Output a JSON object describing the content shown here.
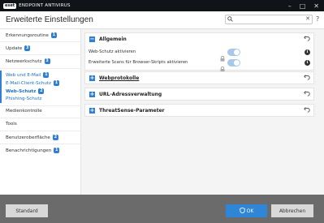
{
  "titlebar": {
    "logo": "eset",
    "product": "ENDPOINT ANTIVIRUS",
    "minimize": "–",
    "maximize": "□",
    "close": "✕"
  },
  "header": {
    "title": "Erweiterte Einstellungen",
    "search_value": "",
    "search_clear": "✕",
    "help": "?"
  },
  "sidebar": {
    "items": [
      {
        "label": "Erkennungsroutine",
        "badge": "1"
      },
      {
        "label": "Update",
        "badge": "3"
      },
      {
        "label": "Netzwerkschutz",
        "badge": "3"
      },
      {
        "label": "Web und E-Mail",
        "badge": "1"
      },
      {
        "label": "E-Mail-Client-Schutz",
        "badge": "1"
      },
      {
        "label": "Web-Schutz",
        "badge": "2"
      },
      {
        "label": "Phishing-Schutz",
        "badge": ""
      },
      {
        "label": "Medienkontrolle",
        "badge": ""
      },
      {
        "label": "Tools",
        "badge": ""
      },
      {
        "label": "Benutzeroberfläche",
        "badge": "2"
      },
      {
        "label": "Benachrichtigungen",
        "badge": "1"
      }
    ]
  },
  "content": {
    "sections": [
      {
        "title": "Allgemein",
        "toggle": "−",
        "rows": [
          {
            "label": "Web-Schutz aktivieren",
            "enabled": true
          },
          {
            "label": "Erweiterte Scans für Browser-Skripts aktivieren",
            "enabled": true
          }
        ]
      },
      {
        "title": "Webprotokolle",
        "toggle": "+"
      },
      {
        "title": "URL-Adressverwaltung",
        "toggle": "+"
      },
      {
        "title": "ThreatSense-Parameter",
        "toggle": "+"
      }
    ],
    "info_glyph": "i"
  },
  "icons": {
    "undo": "undo-icon",
    "lock": "lock-icon",
    "info": "info-icon",
    "search": "search-icon"
  },
  "colors": {
    "accent": "#2f86d6",
    "footer": "#6b6b6b",
    "titlebar": "#101418"
  },
  "footer": {
    "standard": "Standard",
    "ok": "OK",
    "cancel": "Abbrechen"
  }
}
